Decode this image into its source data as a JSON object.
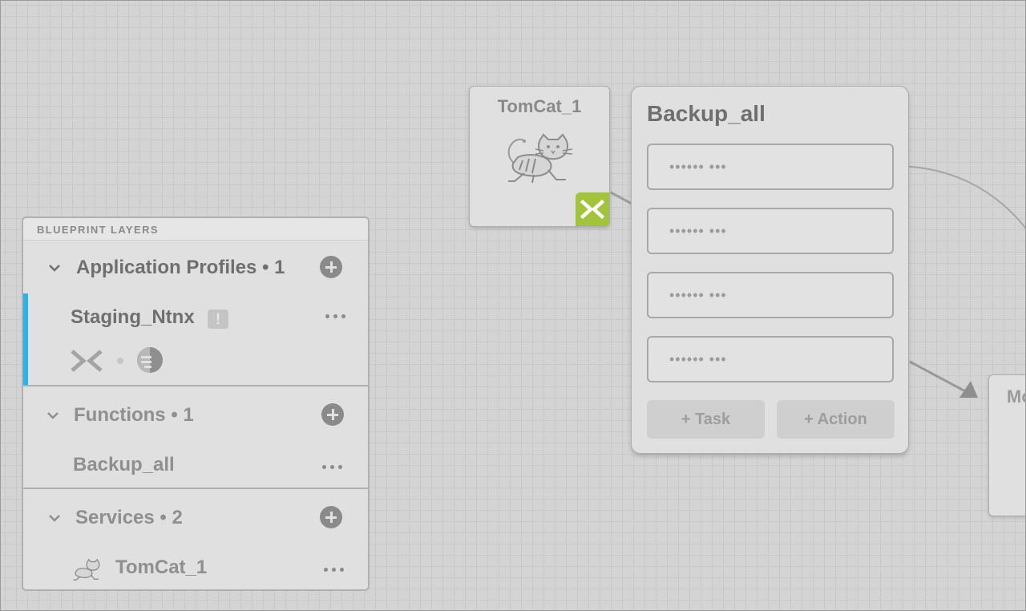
{
  "canvas": {
    "service_node": {
      "title": "TomCat_1",
      "icon": "tomcat-icon",
      "provider_badge_icon": "nutanix-icon"
    },
    "function_card": {
      "title": "Backup_all",
      "task_slots": [
        "•••••• •••",
        "•••••• •••",
        "•••••• •••",
        "•••••• •••"
      ],
      "add_task_label": "+ Task",
      "add_action_label": "+ Action"
    },
    "right_card": {
      "title_partial": "Mo"
    }
  },
  "layers": {
    "header": "BLUEPRINT LAYERS",
    "sections": [
      {
        "name": "Application Profiles • 1",
        "items": [
          {
            "name": "Staging_Ntnx",
            "warning": "!",
            "selected": true,
            "provider_icons": [
              "nutanix-icon",
              "os-icon"
            ]
          }
        ]
      },
      {
        "name": "Functions • 1",
        "items": [
          {
            "name": "Backup_all"
          }
        ]
      },
      {
        "name": "Services • 2",
        "items": [
          {
            "name": "TomCat_1",
            "icon": "tomcat-icon"
          }
        ]
      }
    ]
  },
  "colors": {
    "selection_accent": "#2ab4ee",
    "nutanix_green": "#a3c43a"
  }
}
